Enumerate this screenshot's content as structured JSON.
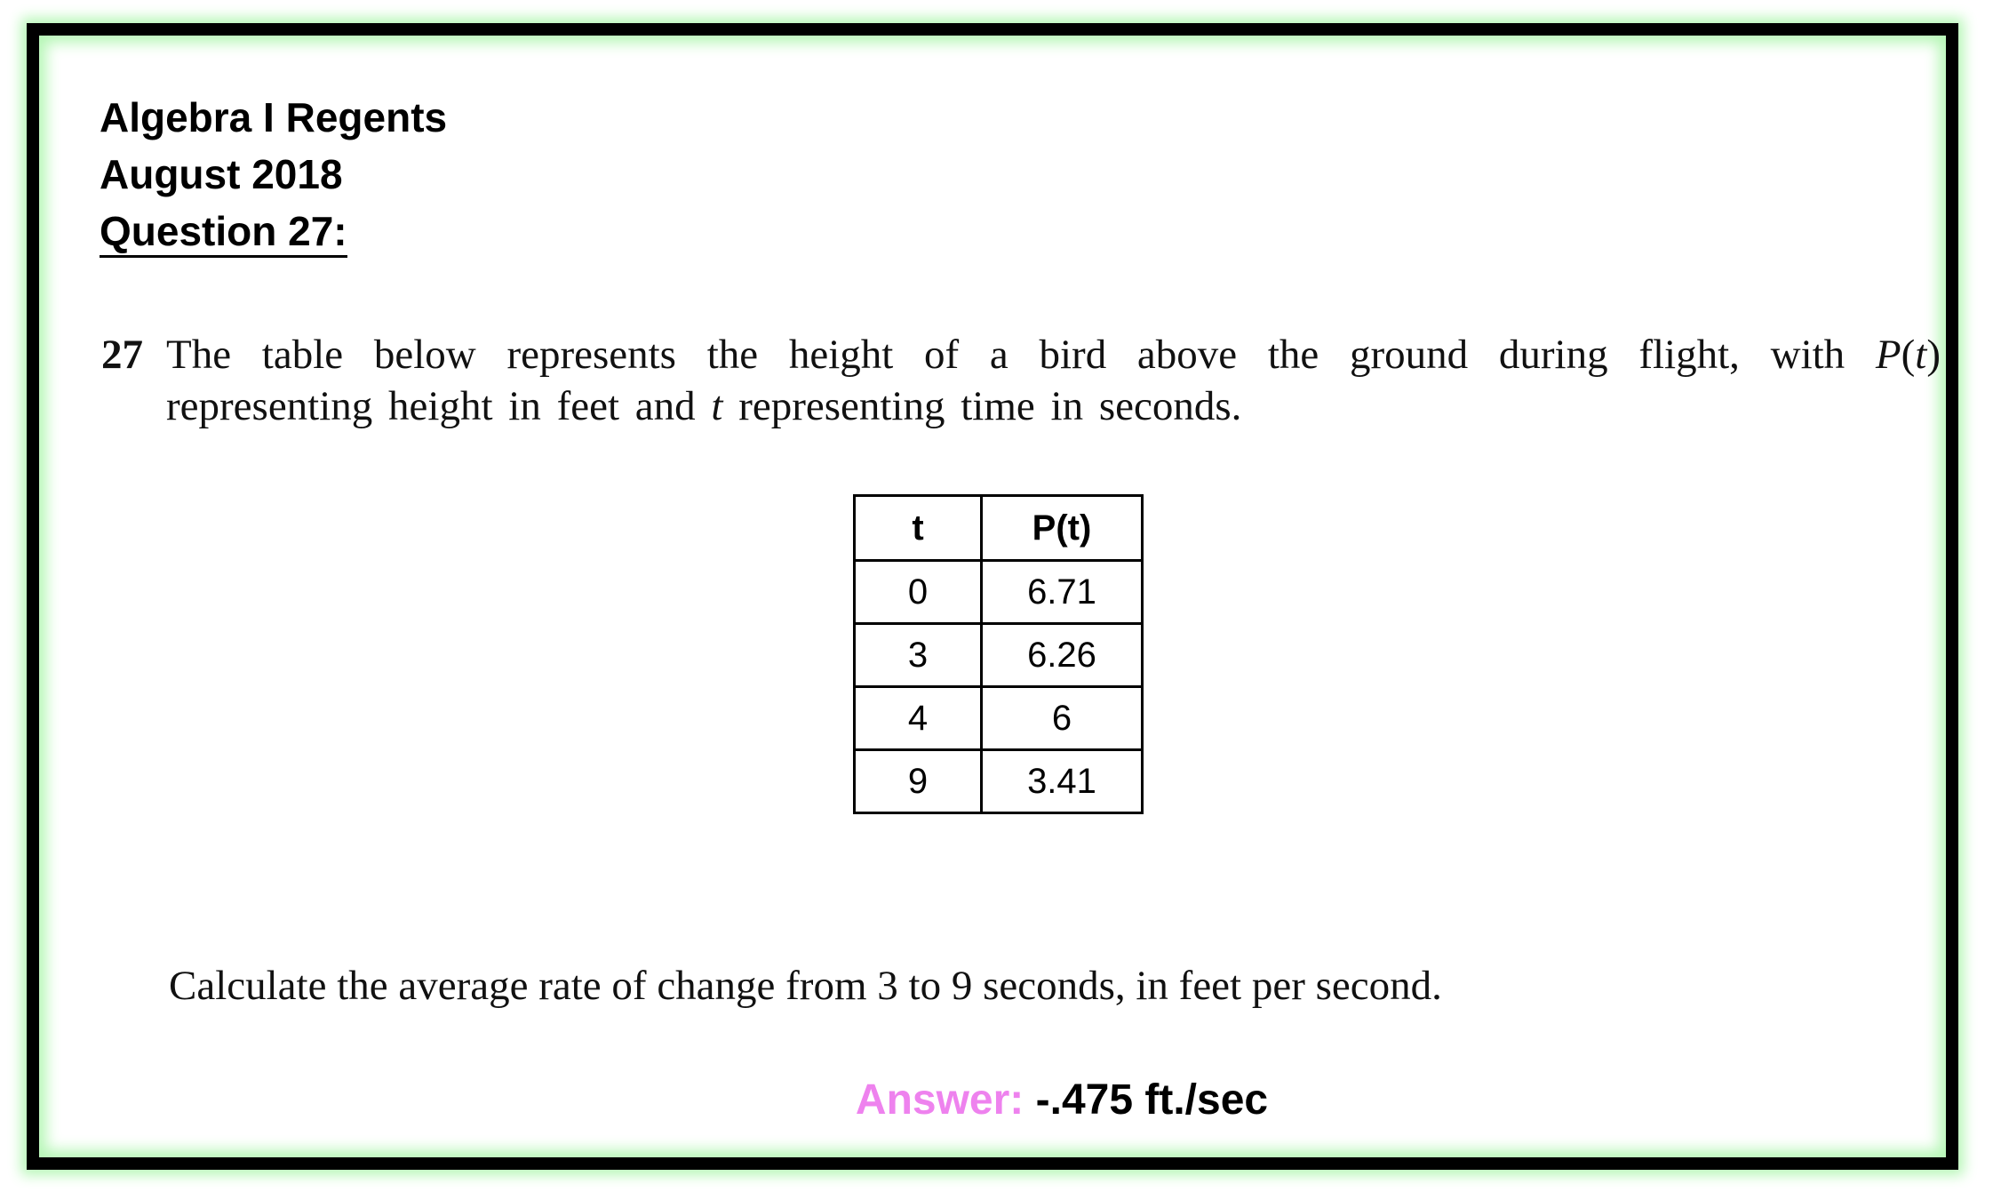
{
  "header": {
    "line1": "Algebra I Regents",
    "line2": "August 2018",
    "line3": "Question 27:"
  },
  "question": {
    "number": "27",
    "line1_text": "The table below represents the height of a bird above the ground during flight, with ",
    "line1_func": "P",
    "line1_func_arg_open": "(",
    "line1_func_arg": "t",
    "line1_func_arg_close": ")",
    "line2_before": "representing height in feet and ",
    "line2_var": "t",
    "line2_after": " representing time in seconds."
  },
  "table": {
    "headers": [
      "t",
      "P(t)"
    ],
    "rows": [
      [
        "0",
        "6.71"
      ],
      [
        "3",
        "6.26"
      ],
      [
        "4",
        "6"
      ],
      [
        "9",
        "3.41"
      ]
    ]
  },
  "prompt": "Calculate the average rate of change from 3 to 9 seconds, in feet per second.",
  "answer": {
    "label": "Answer:",
    "value": "-.475 ft./sec",
    "label_color": "#ee82ee"
  },
  "frame": {
    "border_color": "#000000",
    "glow_color": "#b6f7b6"
  }
}
